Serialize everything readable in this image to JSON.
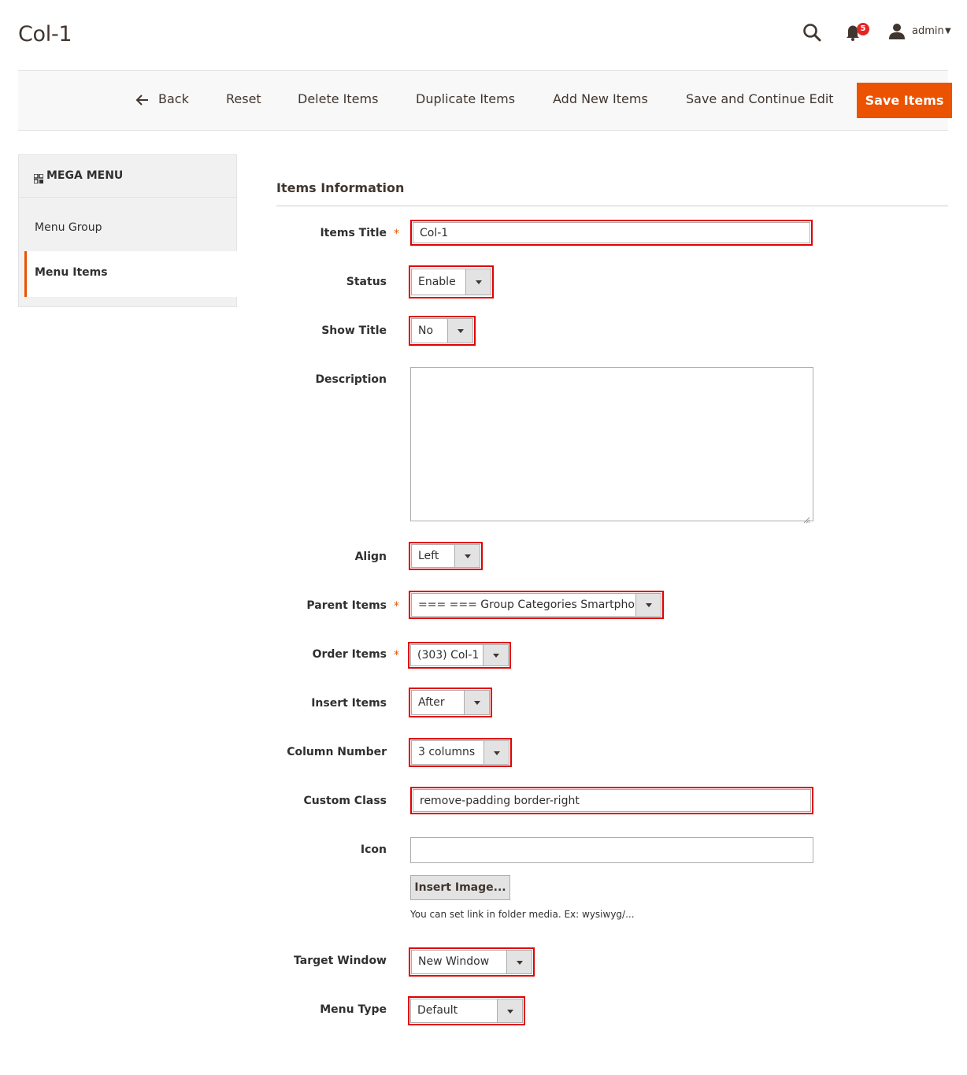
{
  "header": {
    "page_title": "Col-1",
    "notifications_count": "5",
    "user_name": "admin"
  },
  "toolbar": {
    "back_label": "Back",
    "reset_label": "Reset",
    "delete_label": "Delete Items",
    "duplicate_label": "Duplicate Items",
    "add_new_label": "Add New Items",
    "save_continue_label": "Save and Continue Edit",
    "save_label": "Save Items"
  },
  "sidebar": {
    "heading": "MEGA MENU",
    "items": [
      {
        "label": "Menu Group"
      },
      {
        "label": "Menu Items"
      }
    ]
  },
  "form": {
    "section_title": "Items Information",
    "items_title": {
      "label": "Items Title",
      "value": "Col-1"
    },
    "status": {
      "label": "Status",
      "value": "Enable"
    },
    "show_title": {
      "label": "Show Title",
      "value": "No"
    },
    "description": {
      "label": "Description",
      "value": ""
    },
    "align": {
      "label": "Align",
      "value": "Left"
    },
    "parent_items": {
      "label": "Parent Items",
      "value": "=== === Group Categories Smartphone"
    },
    "order_items": {
      "label": "Order Items",
      "value": "(303) Col-1"
    },
    "insert_items": {
      "label": "Insert Items",
      "value": "After"
    },
    "column_number": {
      "label": "Column Number",
      "value": "3 columns"
    },
    "custom_class": {
      "label": "Custom Class",
      "value": "remove-padding border-right"
    },
    "icon": {
      "label": "Icon",
      "value": "",
      "button_label": "Insert Image...",
      "note": "You can set link in folder media. Ex: wysiwyg/..."
    },
    "target_window": {
      "label": "Target Window",
      "value": "New Window"
    },
    "menu_type": {
      "label": "Menu Type",
      "value": "Default"
    }
  },
  "colors": {
    "accent": "#eb5202",
    "highlight_box": "#e10000",
    "badge": "#e22626"
  }
}
